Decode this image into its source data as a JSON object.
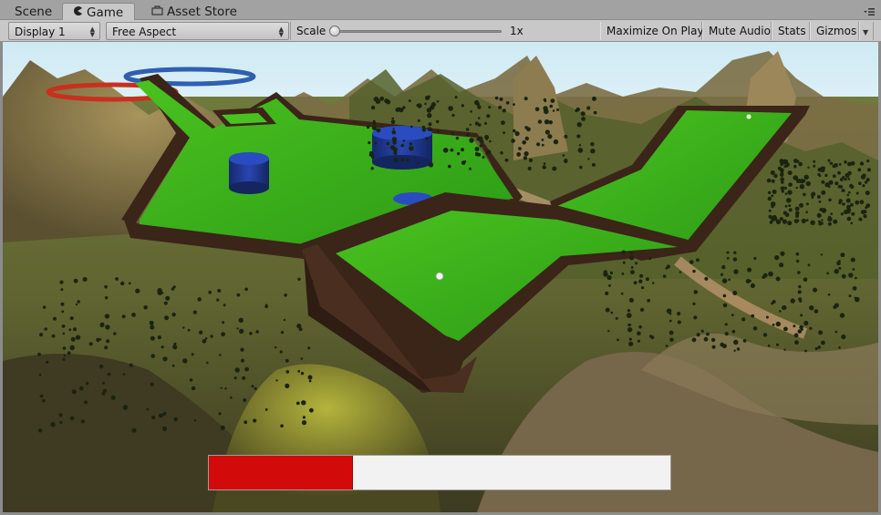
{
  "tabs": [
    {
      "label": "Scene",
      "icon": "scene-icon",
      "active": false
    },
    {
      "label": "Game",
      "icon": "pacman-icon",
      "active": true
    },
    {
      "label": "Asset Store",
      "icon": "store-icon",
      "active": false
    }
  ],
  "toolbar": {
    "display": "Display 1",
    "aspect": "Free Aspect",
    "scale_label": "Scale",
    "scale_value": "1x",
    "maximize_label": "Maximize On Play",
    "mute_label": "Mute Audio",
    "stats_label": "Stats",
    "gizmos_label": "Gizmos"
  },
  "game": {
    "power_fraction": 0.313,
    "colors": {
      "power_fill": "#d30a0a",
      "power_bg": "#f2f2f2",
      "grass": "#3fb01f",
      "wall": "#3b2418",
      "obstacle": "#1f3a9a",
      "sky": "#d6eef6"
    }
  }
}
